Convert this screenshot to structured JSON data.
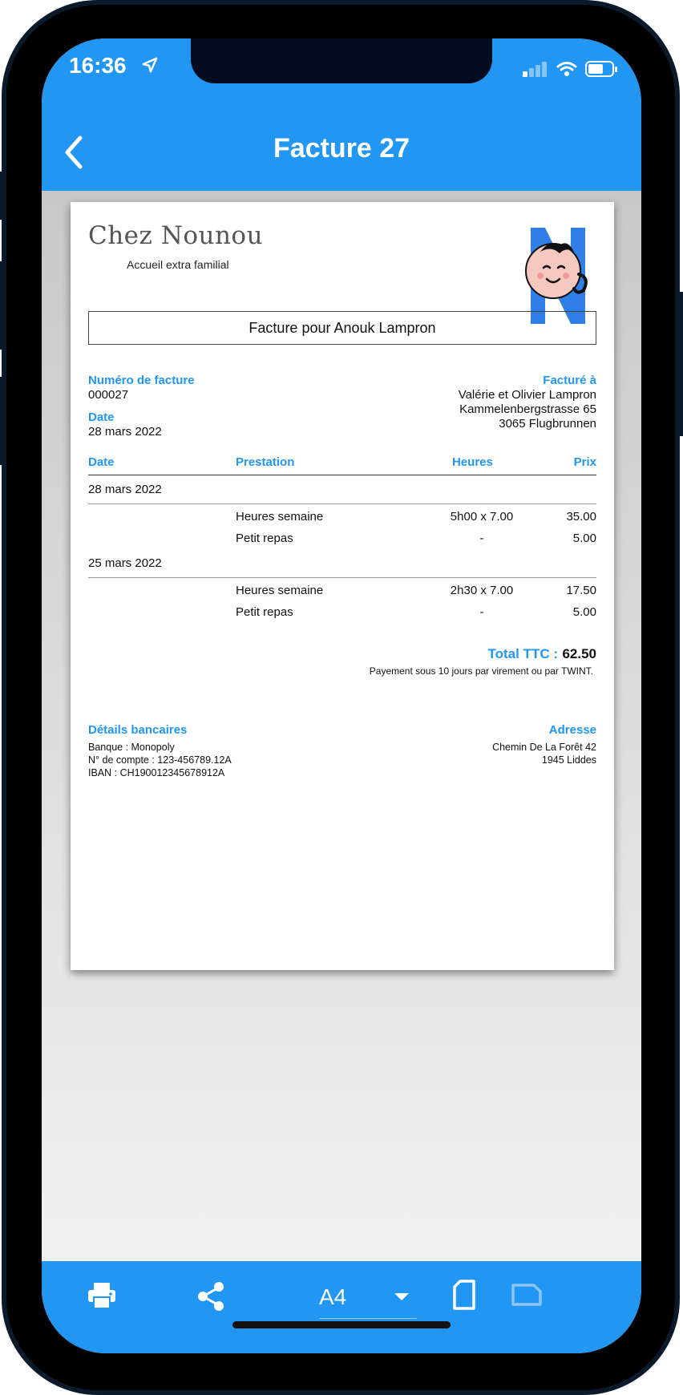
{
  "status_bar": {
    "time": "16:36"
  },
  "nav": {
    "title": "Facture 27"
  },
  "invoice": {
    "brand": "Chez Nounou",
    "brand_sub": "Accueil extra familial",
    "invoice_for": "Facture pour Anouk Lampron",
    "number_label": "Numéro de facture",
    "number": "000027",
    "date_label": "Date",
    "date": "28 mars 2022",
    "billed_label": "Facturé à",
    "billed_lines": [
      "Valérie et Olivier Lampron",
      "Kammelenbergstrasse 65",
      "3065 Flugbrunnen"
    ],
    "columns": [
      "Date",
      "Prestation",
      "Heures",
      "Prix"
    ],
    "groups": [
      {
        "date": "28 mars 2022",
        "rows": [
          {
            "service": "Heures semaine",
            "hours": "5h00 x 7.00",
            "price": "35.00"
          },
          {
            "service": "Petit repas",
            "hours": "-",
            "price": "5.00"
          }
        ]
      },
      {
        "date": "25 mars 2022",
        "rows": [
          {
            "service": "Heures semaine",
            "hours": "2h30 x 7.00",
            "price": "17.50"
          },
          {
            "service": "Petit repas",
            "hours": "-",
            "price": "5.00"
          }
        ]
      }
    ],
    "total_label": "Total TTC :",
    "total": "62.50",
    "payment_note": "Payement sous 10 jours par virement ou par TWINT.",
    "bank_label": "Détails bancaires",
    "bank_lines": [
      "Banque : Monopoly",
      "N° de compte : 123-456789.12A",
      "IBAN : CH190012345678912A"
    ],
    "address_label": "Adresse",
    "address_lines": [
      "Chemin De La Forêt 42",
      "1945 Liddes"
    ]
  },
  "toolbar": {
    "page_size": "A4"
  },
  "icons": [
    "back-chevron-icon",
    "location-arrow-icon",
    "signal-icon",
    "wifi-icon",
    "battery-icon",
    "print-icon",
    "share-icon",
    "dropdown-arrow-icon",
    "portrait-page-icon",
    "landscape-page-icon"
  ],
  "colors": {
    "accent": "#2196f3",
    "page": "#ffffff"
  }
}
